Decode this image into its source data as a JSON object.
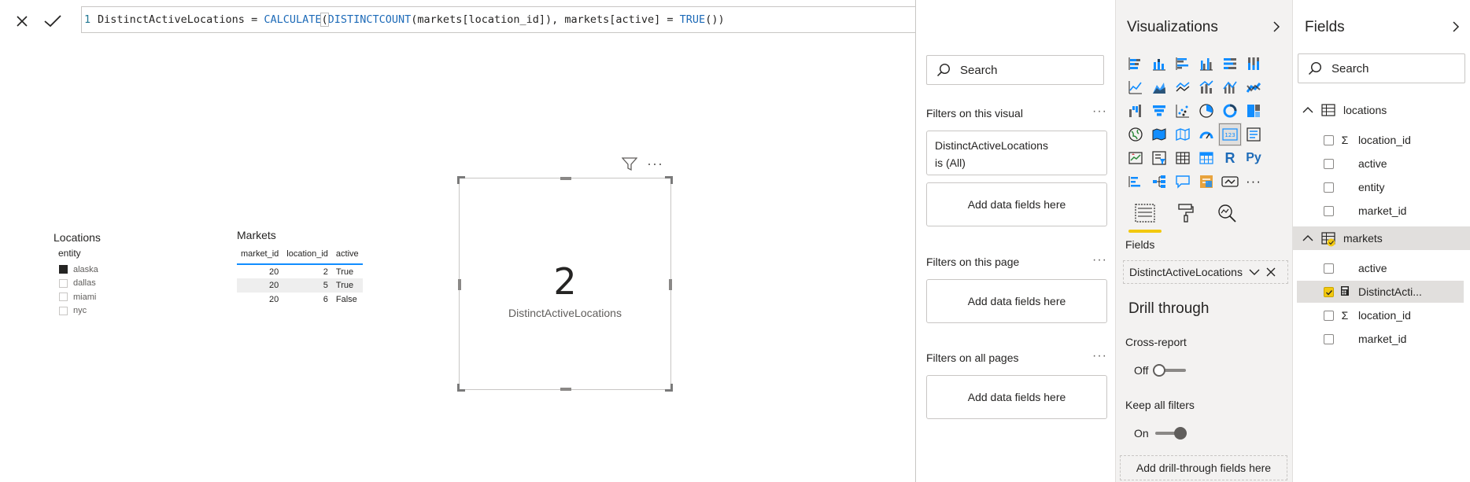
{
  "formula": {
    "line_number": "1",
    "measure": "DistinctActiveLocations = ",
    "fn1": "CALCULATE",
    "paren1": "(",
    "fn2": "DISTINCTCOUNT",
    "arg1": "(markets[location_id]), markets[active] = ",
    "fn3": "TRUE",
    "tail": "())"
  },
  "canvas": {
    "slicer": {
      "title": "Locations",
      "header": "entity",
      "items": [
        {
          "label": "alaska",
          "checked": true
        },
        {
          "label": "dallas",
          "checked": false
        },
        {
          "label": "miami",
          "checked": false
        },
        {
          "label": "nyc",
          "checked": false
        }
      ]
    },
    "table": {
      "title": "Markets",
      "columns": [
        "market_id",
        "location_id",
        "active"
      ],
      "rows": [
        [
          "20",
          "2",
          "True"
        ],
        [
          "20",
          "5",
          "True"
        ],
        [
          "20",
          "6",
          "False"
        ]
      ]
    },
    "card": {
      "value": "2",
      "label": "DistinctActiveLocations",
      "more": "···"
    }
  },
  "filters": {
    "search_placeholder": "Search",
    "visual_title": "Filters on this visual",
    "visual_filter_line1": "DistinctActiveLocations",
    "visual_filter_line2": "is (All)",
    "add_fields": "Add data fields here",
    "page_title": "Filters on this page",
    "all_title": "Filters on all pages",
    "dots": "···"
  },
  "visualizations": {
    "title": "Visualizations",
    "more": "···",
    "r_label": "R",
    "py_label": "Py",
    "fields_label": "Fields",
    "well_value": "DistinctActiveLocations",
    "drill_title": "Drill through",
    "cross_report_label": "Cross-report",
    "cross_report_state": "Off",
    "keep_filters_label": "Keep all filters",
    "keep_filters_state": "On",
    "drill_add": "Add drill-through fields here"
  },
  "fields": {
    "title": "Fields",
    "search_placeholder": "Search",
    "tables": [
      {
        "name": "locations",
        "fields": [
          {
            "name": "location_id",
            "type": "Σ",
            "checked": false
          },
          {
            "name": "active",
            "type": "",
            "checked": false
          },
          {
            "name": "entity",
            "type": "",
            "checked": false
          },
          {
            "name": "market_id",
            "type": "",
            "checked": false
          }
        ]
      },
      {
        "name": "markets",
        "fields": [
          {
            "name": "active",
            "type": "",
            "checked": false
          },
          {
            "name": "DistinctActi...",
            "type": "calc",
            "checked": true
          },
          {
            "name": "location_id",
            "type": "Σ",
            "checked": false
          },
          {
            "name": "market_id",
            "type": "",
            "checked": false
          }
        ]
      }
    ]
  },
  "colors": {
    "accent_yellow": "#f2c80f",
    "table_underline": "#118dff",
    "keyword_blue": "#1e6bb8",
    "viz_blue": "#118dff"
  }
}
